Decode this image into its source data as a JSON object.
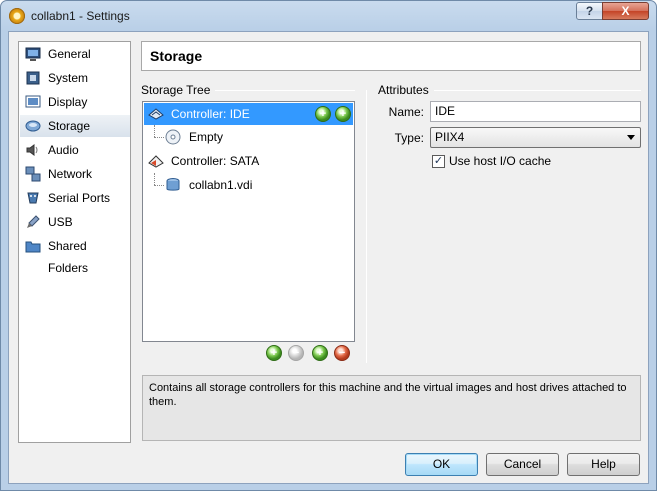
{
  "window": {
    "title": "collabn1 - Settings",
    "help_glyph": "?",
    "close_glyph": "X"
  },
  "sidebar": {
    "items": [
      {
        "label": "General",
        "icon": "monitor-icon"
      },
      {
        "label": "System",
        "icon": "chip-icon"
      },
      {
        "label": "Display",
        "icon": "display-icon"
      },
      {
        "label": "Storage",
        "icon": "disk-icon",
        "selected": true
      },
      {
        "label": "Audio",
        "icon": "speaker-icon"
      },
      {
        "label": "Network",
        "icon": "network-icon"
      },
      {
        "label": "Serial Ports",
        "icon": "serial-port-icon"
      },
      {
        "label": "USB",
        "icon": "usb-icon"
      },
      {
        "label": "Shared Folders",
        "icon": "folder-icon"
      }
    ]
  },
  "page": {
    "title": "Storage"
  },
  "storage_tree": {
    "label": "Storage Tree",
    "items": [
      {
        "label": "Controller: IDE",
        "selected": true
      },
      {
        "label": "Empty"
      },
      {
        "label": "Controller: SATA"
      },
      {
        "label": "collabn1.vdi"
      }
    ]
  },
  "attributes": {
    "label": "Attributes",
    "name_label": "Name:",
    "name_value": "IDE",
    "type_label": "Type:",
    "type_value": "PIIX4",
    "cache_label": "Use host I/O cache",
    "cache_checked": true,
    "check_glyph": "✓"
  },
  "description": "Contains all storage controllers for this machine and the virtual images and host drives attached to them.",
  "buttons": {
    "ok": "OK",
    "cancel": "Cancel",
    "help": "Help"
  },
  "colors": {
    "selection": "#3399ff",
    "title_bar": "#b9cfe7"
  }
}
